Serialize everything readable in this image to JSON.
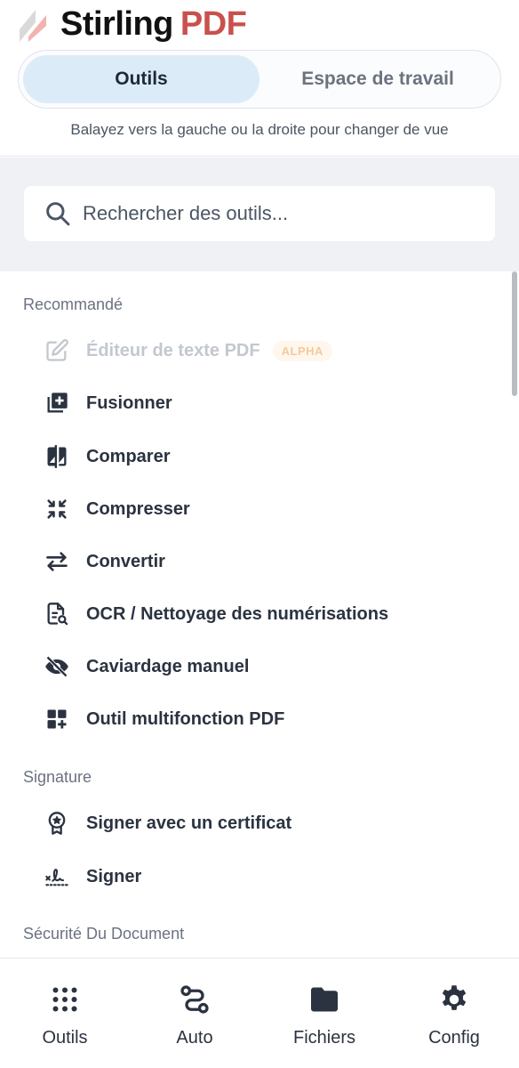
{
  "brand": {
    "name_part1": "Stirling",
    "name_part2": "PDF"
  },
  "view_switcher": {
    "tools_label": "Outils",
    "workspace_label": "Espace de travail",
    "active": "tools"
  },
  "swipe_hint": "Balayez vers la gauche ou la droite pour changer de vue",
  "search": {
    "placeholder": "Rechercher des outils..."
  },
  "sections": {
    "recommended": {
      "title": "Recommandé",
      "items": [
        {
          "label": "Éditeur de texte PDF",
          "icon": "edit-icon",
          "badge": "ALPHA",
          "disabled": true
        },
        {
          "label": "Fusionner",
          "icon": "merge-icon"
        },
        {
          "label": "Comparer",
          "icon": "compare-icon"
        },
        {
          "label": "Compresser",
          "icon": "compress-icon"
        },
        {
          "label": "Convertir",
          "icon": "convert-icon"
        },
        {
          "label": "OCR / Nettoyage des numérisations",
          "icon": "ocr-icon"
        },
        {
          "label": "Caviardage manuel",
          "icon": "redact-icon"
        },
        {
          "label": "Outil multifonction PDF",
          "icon": "multitool-icon"
        }
      ]
    },
    "signature": {
      "title": "Signature",
      "items": [
        {
          "label": "Signer avec un certificat",
          "icon": "certificate-icon"
        },
        {
          "label": "Signer",
          "icon": "signature-icon"
        }
      ]
    },
    "security": {
      "title": "Sécurité Du Document"
    }
  },
  "bottom_nav": [
    {
      "label": "Outils",
      "icon": "grid-icon"
    },
    {
      "label": "Auto",
      "icon": "automation-icon"
    },
    {
      "label": "Fichiers",
      "icon": "folder-icon"
    },
    {
      "label": "Config",
      "icon": "gear-icon"
    }
  ],
  "colors": {
    "brand_red": "#c9514d",
    "active_tab": "#dcebf8",
    "search_band": "#eff1f5"
  }
}
